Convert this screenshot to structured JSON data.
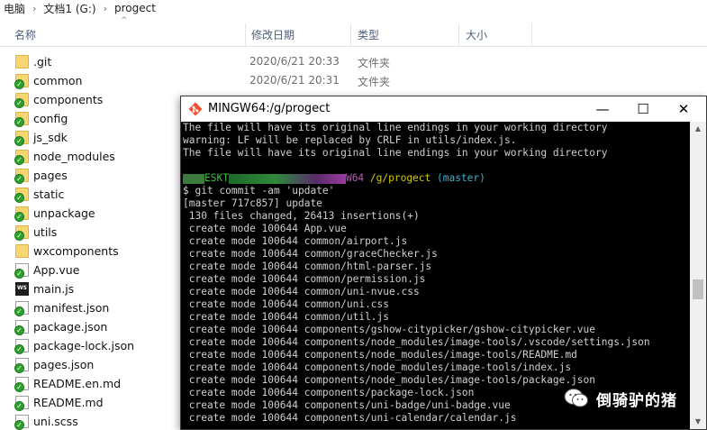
{
  "breadcrumb": [
    "电脑",
    "文档1 (G:)",
    "progect"
  ],
  "columns": {
    "name": "名称",
    "date": "修改日期",
    "type": "类型",
    "size": "大小"
  },
  "files": [
    {
      "name": ".git",
      "date": "2020/6/21 20:33",
      "type": "文件夹",
      "icon": "folder-icon",
      "synced": false
    },
    {
      "name": "common",
      "date": "2020/6/21 20:31",
      "type": "文件夹",
      "icon": "folder-icon",
      "synced": true
    },
    {
      "name": "components",
      "date": "",
      "type": "",
      "icon": "folder-icon",
      "synced": true
    },
    {
      "name": "config",
      "date": "",
      "type": "",
      "icon": "folder-icon",
      "synced": true
    },
    {
      "name": "js_sdk",
      "date": "",
      "type": "",
      "icon": "folder-icon",
      "synced": true
    },
    {
      "name": "node_modules",
      "date": "",
      "type": "",
      "icon": "folder-icon",
      "synced": true
    },
    {
      "name": "pages",
      "date": "",
      "type": "",
      "icon": "folder-icon",
      "synced": true
    },
    {
      "name": "static",
      "date": "",
      "type": "",
      "icon": "folder-icon",
      "synced": true
    },
    {
      "name": "unpackage",
      "date": "",
      "type": "",
      "icon": "folder-icon",
      "synced": true
    },
    {
      "name": "utils",
      "date": "",
      "type": "",
      "icon": "folder-icon",
      "synced": true
    },
    {
      "name": "wxcomponents",
      "date": "",
      "type": "",
      "icon": "folder-icon",
      "synced": false
    },
    {
      "name": "App.vue",
      "date": "",
      "type": "",
      "icon": "file-icon",
      "synced": true
    },
    {
      "name": "main.js",
      "date": "",
      "type": "",
      "icon": "webstorm-file-icon",
      "synced": false
    },
    {
      "name": "manifest.json",
      "date": "",
      "type": "",
      "icon": "file-icon",
      "synced": true
    },
    {
      "name": "package.json",
      "date": "",
      "type": "",
      "icon": "file-icon",
      "synced": true
    },
    {
      "name": "package-lock.json",
      "date": "",
      "type": "",
      "icon": "file-icon",
      "synced": true
    },
    {
      "name": "pages.json",
      "date": "",
      "type": "",
      "icon": "file-icon",
      "synced": true
    },
    {
      "name": "README.en.md",
      "date": "",
      "type": "",
      "icon": "file-icon",
      "synced": true
    },
    {
      "name": "README.md",
      "date": "",
      "type": "",
      "icon": "file-icon",
      "synced": true
    },
    {
      "name": "uni.scss",
      "date": "",
      "type": "",
      "icon": "file-icon",
      "synced": true
    }
  ],
  "terminal": {
    "title": "MINGW64:/g/progect",
    "buttons": {
      "minimize": "—",
      "maximize": "☐",
      "close": "✕"
    },
    "lines": [
      [
        {
          "t": "The file will have its original line endings in your working directory",
          "c": ""
        }
      ],
      [
        {
          "t": "warning: LF will be replaced by CRLF in utils/index.js.",
          "c": ""
        }
      ],
      [
        {
          "t": "The file will have its original line endings in your working directory",
          "c": ""
        }
      ],
      [
        {
          "t": "",
          "c": ""
        }
      ],
      [
        {
          "t": "ESKT",
          "c": "c-green"
        },
        {
          "t": "W64 ",
          "c": "c-purple"
        },
        {
          "t": "/g/progect ",
          "c": "c-yellow"
        },
        {
          "t": "(master)",
          "c": "c-cyan"
        }
      ],
      [
        {
          "t": "$ git commit -am 'update'",
          "c": ""
        }
      ],
      [
        {
          "t": "[master 717c857] update",
          "c": ""
        }
      ],
      [
        {
          "t": " 130 files changed, 26413 insertions(+)",
          "c": ""
        }
      ],
      [
        {
          "t": " create mode 100644 App.vue",
          "c": ""
        }
      ],
      [
        {
          "t": " create mode 100644 common/airport.js",
          "c": ""
        }
      ],
      [
        {
          "t": " create mode 100644 common/graceChecker.js",
          "c": ""
        }
      ],
      [
        {
          "t": " create mode 100644 common/html-parser.js",
          "c": ""
        }
      ],
      [
        {
          "t": " create mode 100644 common/permission.js",
          "c": ""
        }
      ],
      [
        {
          "t": " create mode 100644 common/uni-nvue.css",
          "c": ""
        }
      ],
      [
        {
          "t": " create mode 100644 common/uni.css",
          "c": ""
        }
      ],
      [
        {
          "t": " create mode 100644 common/util.js",
          "c": ""
        }
      ],
      [
        {
          "t": " create mode 100644 components/gshow-citypicker/gshow-citypicker.vue",
          "c": ""
        }
      ],
      [
        {
          "t": " create mode 100644 components/node_modules/image-tools/.vscode/settings.json",
          "c": ""
        }
      ],
      [
        {
          "t": " create mode 100644 components/node_modules/image-tools/README.md",
          "c": ""
        }
      ],
      [
        {
          "t": " create mode 100644 components/node_modules/image-tools/index.js",
          "c": ""
        }
      ],
      [
        {
          "t": " create mode 100644 components/node_modules/image-tools/package.json",
          "c": ""
        }
      ],
      [
        {
          "t": " create mode 100644 components/package-lock.json",
          "c": ""
        }
      ],
      [
        {
          "t": " create mode 100644 components/uni-badge/uni-badge.vue",
          "c": ""
        }
      ],
      [
        {
          "t": " create mode 100644 components/uni-calendar/calendar.js",
          "c": ""
        }
      ]
    ]
  },
  "watermark": {
    "text": "倒骑驴的猪"
  }
}
